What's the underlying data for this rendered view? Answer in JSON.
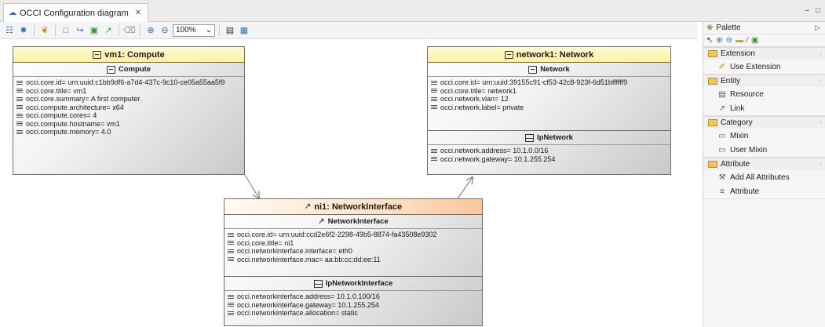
{
  "editor": {
    "tab_title": "OCCI Configuration diagram",
    "tab_close": "✕",
    "window_minimize": "–",
    "window_maximize": "□"
  },
  "toolbar": {
    "zoom_value": "100%",
    "zoom_arrow": "⌄"
  },
  "nodes": {
    "vm1": {
      "title": "vm1: Compute",
      "sections": [
        {
          "name": "Compute",
          "attributes": [
            "occi.core.id= urn:uuid:c1bb9df6-a7d4-437c-9c10-ce05a55aa5f9",
            "occi.core.title= vm1",
            "occi.core.summary= A first computer.",
            "occi.compute.architecture= x64",
            "occi.compute.cores= 4",
            "occi.compute.hostname= vm1",
            "occi.compute.memory= 4.0"
          ]
        }
      ]
    },
    "network1": {
      "title": "network1: Network",
      "sections": [
        {
          "name": "Network",
          "attributes": [
            "occi.core.id= urn:uuid:39155c91-cf53-42c8-923f-6d51bffffff9",
            "occi.core.title= network1",
            "occi.network.vlan= 12",
            "occi.network.label= private"
          ]
        },
        {
          "name": "IpNetwork",
          "attributes": [
            "occi.network.address= 10.1.0.0/16",
            "occi.network.gateway= 10.1.255.254"
          ]
        }
      ]
    },
    "ni1": {
      "title": "ni1: NetworkInterface",
      "sections": [
        {
          "name": "NetworkInterface",
          "attributes": [
            "occi.core.id= urn:uuid:ccd2e6f2-2298-49b5-8874-fa43508e9302",
            "occi.core.title= ni1",
            "occi.networkinterface.interface= eth0",
            "occi.networkinterface.mac= aa:bb:cc:dd:ee:11"
          ]
        },
        {
          "name": "IpNetworkInterface",
          "attributes": [
            "occi.networkinterface.address= 10.1.0.100/16",
            "occi.networkinterface.gateway= 10.1.255.254",
            "occi.networkinterface.allocation= static"
          ]
        }
      ]
    }
  },
  "palette": {
    "title": "Palette",
    "collapse_icon": "▷",
    "drawers": [
      {
        "label": "Extension",
        "items": [
          {
            "label": "Use Extension",
            "icon": "✐"
          }
        ]
      },
      {
        "label": "Entity",
        "items": [
          {
            "label": "Resource",
            "icon": "▤"
          },
          {
            "label": "Link",
            "icon": "↗"
          }
        ]
      },
      {
        "label": "Category",
        "items": [
          {
            "label": "Mixin",
            "icon": "▭"
          },
          {
            "label": "User Mixin",
            "icon": "▭"
          }
        ]
      },
      {
        "label": "Attribute",
        "items": [
          {
            "label": "Add All Attributes",
            "icon": "⚒"
          },
          {
            "label": "Attribute",
            "icon": "≡"
          }
        ]
      }
    ]
  }
}
